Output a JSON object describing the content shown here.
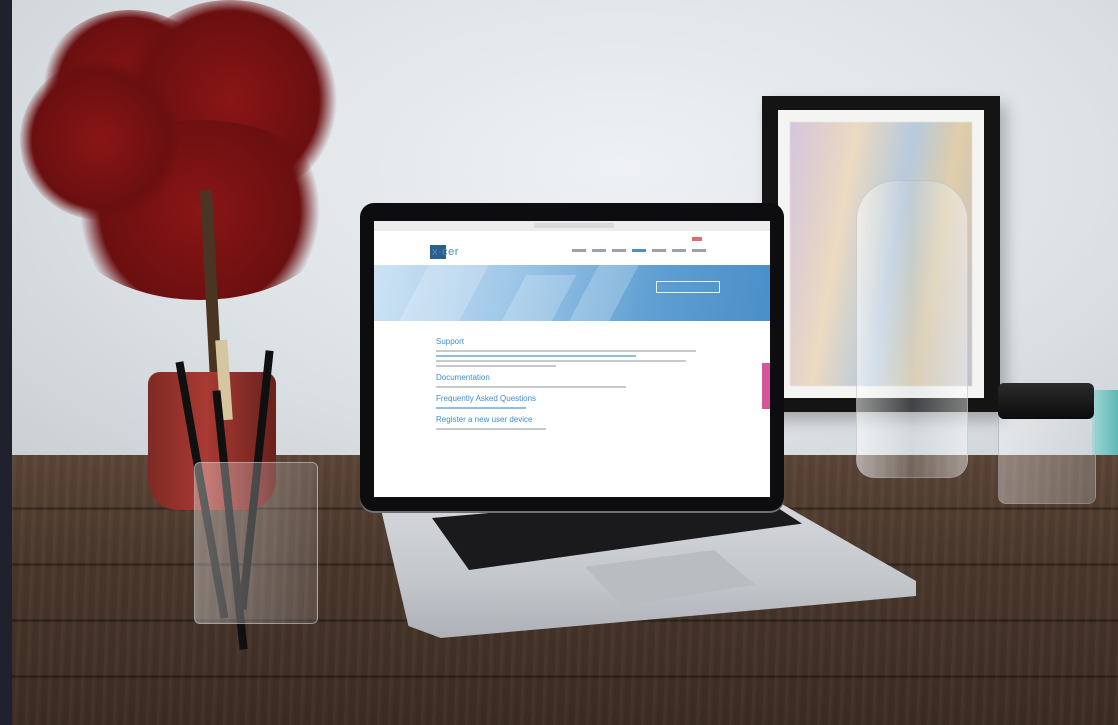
{
  "scene": {
    "description_free": true
  },
  "laptop_screen": {
    "site_logo_text": "x·cer",
    "section_title_1": "Support",
    "section_title_2": "Documentation",
    "section_title_3": "Frequently Asked Questions",
    "section_title_4": "Register a new user device"
  },
  "colors": {
    "accent_blue": "#4a8fc8",
    "side_tab_pink": "#d5559b",
    "desk_wood": "#4a372b",
    "plant_red": "#8a1515"
  }
}
